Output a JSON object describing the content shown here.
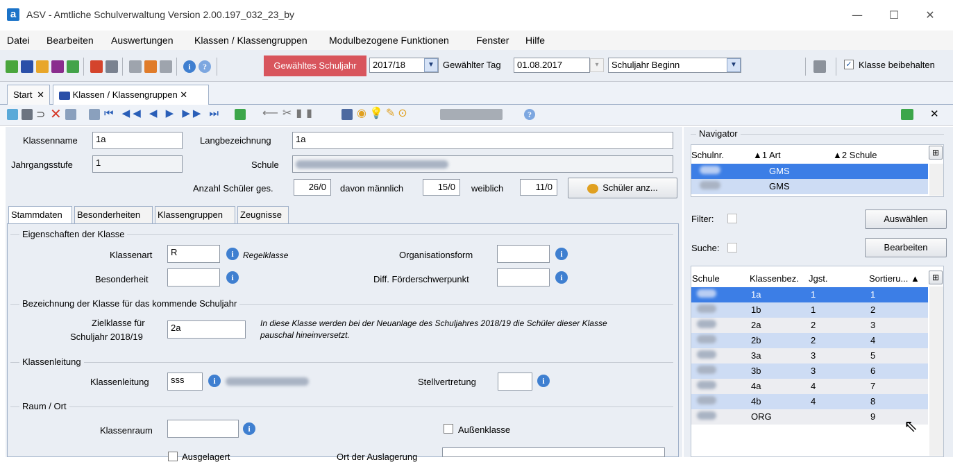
{
  "window": {
    "app_letter": "a",
    "title": "ASV - Amtliche Schulverwaltung Version 2.00.197_032_23_by",
    "btn_min": "—",
    "btn_max": "☐",
    "btn_close": "✕"
  },
  "menu": [
    "Datei",
    "Bearbeiten",
    "Auswertungen",
    "Klassen / Klassengruppen",
    "Modulbezogene Funktionen",
    "Fenster",
    "Hilfe"
  ],
  "toolbar": {
    "schuljahr_label": "Gewähltes Schuljahr",
    "schuljahr_value": "2017/18",
    "tag_label": "Gewählter Tag",
    "tag_value": "01.08.2017",
    "schuljahr_mode": "Schuljahr Beginn",
    "keep_class_label": "Klasse beibehalten",
    "keep_class_checked": "✓"
  },
  "tabs": {
    "start": "Start",
    "klassen": "Klassen / Klassengruppen",
    "close": "✕"
  },
  "form": {
    "klassenname_label": "Klassenname",
    "klassenname": "1a",
    "langbez_label": "Langbezeichnung",
    "langbez": "1a",
    "jgst_label": "Jahrgangsstufe",
    "jgst": "1",
    "schule_label": "Schule",
    "anzahl_label": "Anzahl Schüler ges.",
    "anzahl": "26/0",
    "maennlich_label": "davon männlich",
    "maennlich": "15/0",
    "weiblich_label": "weiblich",
    "weiblich": "11/0",
    "schueler_btn": "Schüler anz..."
  },
  "subtabs": [
    "Stammdaten",
    "Besonderheiten",
    "Klassengruppen",
    "Zeugnisse"
  ],
  "stammdaten": {
    "sec1": "Eigenschaften der Klasse",
    "klassenart_label": "Klassenart",
    "klassenart": "R",
    "klassenart_desc": "Regelklasse",
    "orgform_label": "Organisationsform",
    "besonderheit_label": "Besonderheit",
    "foerder_label": "Diff. Förderschwerpunkt",
    "sec2": "Bezeichnung der Klasse für das kommende Schuljahr",
    "ziel_label_1": "Zielklasse für",
    "ziel_label_2": "Schuljahr 2018/19",
    "ziel": "2a",
    "ziel_note_1": "In diese Klasse werden bei der Neuanlage des Schuljahres 2018/19 die Schüler dieser Klasse",
    "ziel_note_2": "pauschal hineinversetzt.",
    "sec3": "Klassenleitung",
    "kl_label": "Klassenleitung",
    "kl": "sss",
    "stellv_label": "Stellvertretung",
    "sec4": "Raum / Ort",
    "raum_label": "Klassenraum",
    "aussen_label": "Außenklasse",
    "ausgelagert_label": "Ausgelagert",
    "ort_label": "Ort der Auslagerung"
  },
  "navigator": {
    "title": "Navigator",
    "headers": [
      "Schulnr.",
      "▲1 Art",
      "▲2 Schule"
    ],
    "rows": [
      {
        "art": "GMS"
      },
      {
        "art": "GMS"
      }
    ],
    "filter_label": "Filter:",
    "suche_label": "Suche:",
    "auswaehlen_btn": "Auswählen",
    "bearbeiten_btn": "Bearbeiten",
    "grid_headers": [
      "Schule",
      "Klassenbez.",
      "Jgst.",
      "Sortieru... ▲"
    ],
    "classes": [
      {
        "name": "1a",
        "jgst": "1",
        "sort": "1"
      },
      {
        "name": "1b",
        "jgst": "1",
        "sort": "2"
      },
      {
        "name": "2a",
        "jgst": "2",
        "sort": "3"
      },
      {
        "name": "2b",
        "jgst": "2",
        "sort": "4"
      },
      {
        "name": "3a",
        "jgst": "3",
        "sort": "5"
      },
      {
        "name": "3b",
        "jgst": "3",
        "sort": "6"
      },
      {
        "name": "4a",
        "jgst": "4",
        "sort": "7"
      },
      {
        "name": "4b",
        "jgst": "4",
        "sort": "8"
      },
      {
        "name": "ORG",
        "jgst": "",
        "sort": "9"
      }
    ]
  },
  "colors": {
    "accent": "#3c7ee6",
    "schuljahr_bg": "#d8555d",
    "panel_bg": "#eaeef4"
  }
}
